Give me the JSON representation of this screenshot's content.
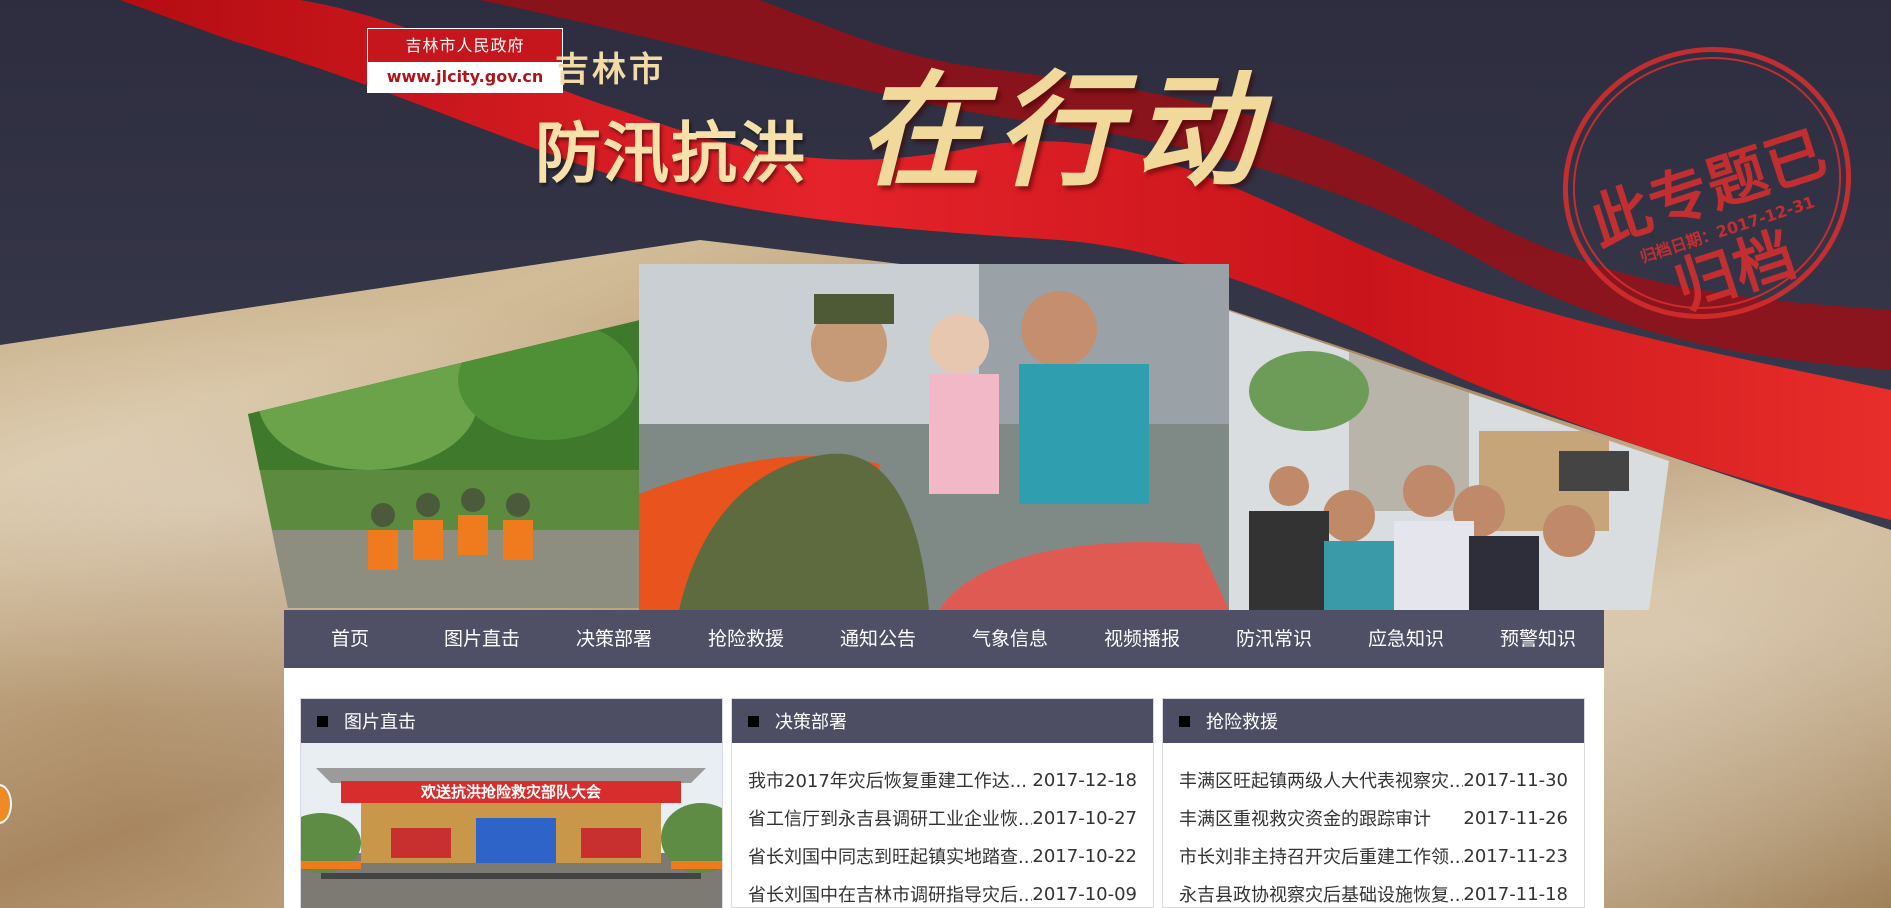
{
  "brand": {
    "site_name": "吉林市人民政府",
    "site_url": "www.jlcity.gov.cn",
    "banner_city": "吉林市",
    "banner_title": "防汛抗洪",
    "banner_slogan": "在行动"
  },
  "stamp": {
    "text": "此专题已归档",
    "sub": "归档日期：2017-12-31",
    "color": "#d72e2e"
  },
  "nav": {
    "items": [
      "首页",
      "图片直击",
      "决策部署",
      "抢险救援",
      "通知公告",
      "气象信息",
      "视频播报",
      "防汛常识",
      "应急知识",
      "预警知识"
    ]
  },
  "panels": {
    "pictures": {
      "title": "图片直击",
      "banner_text": "欢送抗洪抢险救灾部队大会"
    },
    "decisions": {
      "title": "决策部署",
      "items": [
        {
          "title": "我市2017年灾后恢复重建工作达...",
          "date": "2017-12-18"
        },
        {
          "title": "省工信厅到永吉县调研工业企业恢...",
          "date": "2017-10-27"
        },
        {
          "title": "省长刘国中同志到旺起镇实地踏查...",
          "date": "2017-10-22"
        },
        {
          "title": "省长刘国中在吉林市调研指导灾后...",
          "date": "2017-10-09"
        }
      ]
    },
    "rescue": {
      "title": "抢险救援",
      "items": [
        {
          "title": "丰满区旺起镇两级人大代表视察灾...",
          "date": "2017-11-30"
        },
        {
          "title": "丰满区重视救灾资金的跟踪审计",
          "date": "2017-11-26"
        },
        {
          "title": "市长刘非主持召开灾后重建工作领...",
          "date": "2017-11-23"
        },
        {
          "title": "永吉县政协视察灾后基础设施恢复...",
          "date": "2017-11-18"
        }
      ]
    }
  },
  "colors": {
    "nav_bg": "#4f4f66",
    "panel_head_bg": "#4d4d63",
    "brand_red": "#c4161c"
  }
}
